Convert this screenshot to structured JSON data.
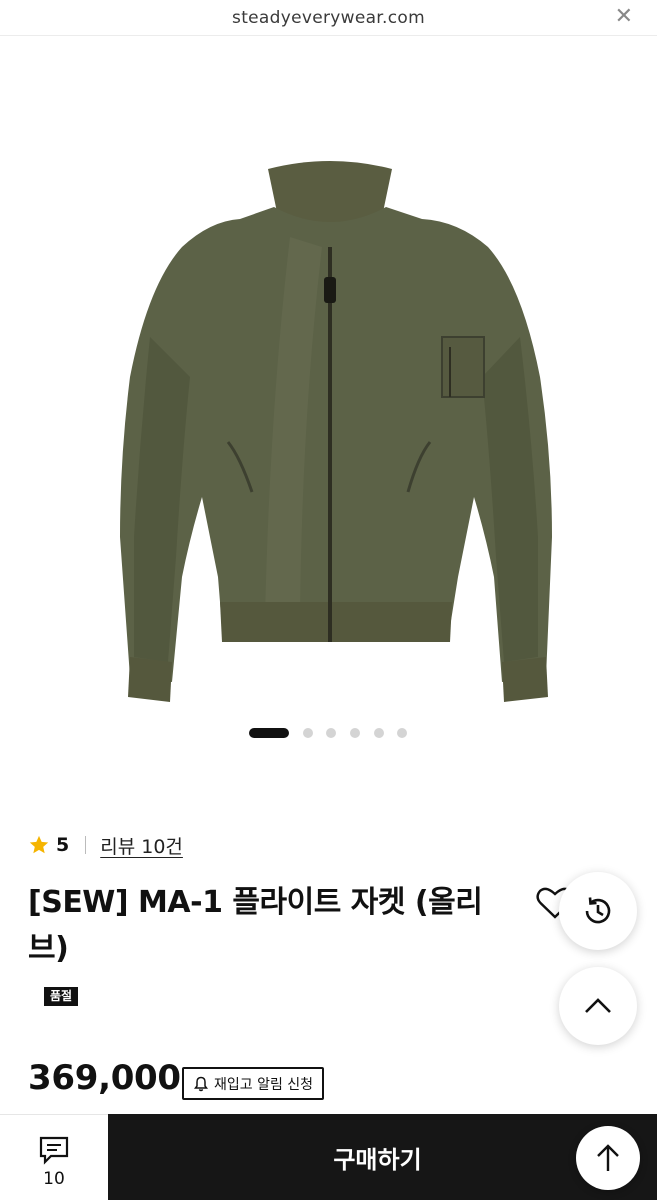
{
  "browser": {
    "url": "steadyeverywear.com",
    "close_glyph": "✕"
  },
  "gallery": {
    "slide_count": 6,
    "active_index": 0
  },
  "product": {
    "rating": "5",
    "review_link": "리뷰 10건",
    "title": "[SEW] MA-1 플라이트 자켓 (올리브)",
    "soldout_badge": "품절",
    "price": "369,000",
    "restock_label": "재입고 알림 신청"
  },
  "bottom_bar": {
    "review_count": "10",
    "buy_label": "구매하기"
  },
  "colors": {
    "jacket": "#5b6147",
    "star": "#f5b400",
    "buy_button": "#161616"
  },
  "icons": [
    "star-icon",
    "heart-icon",
    "history-icon",
    "chevron-up-icon",
    "bell-icon",
    "comment-icon",
    "arrow-up-icon",
    "close-icon"
  ]
}
